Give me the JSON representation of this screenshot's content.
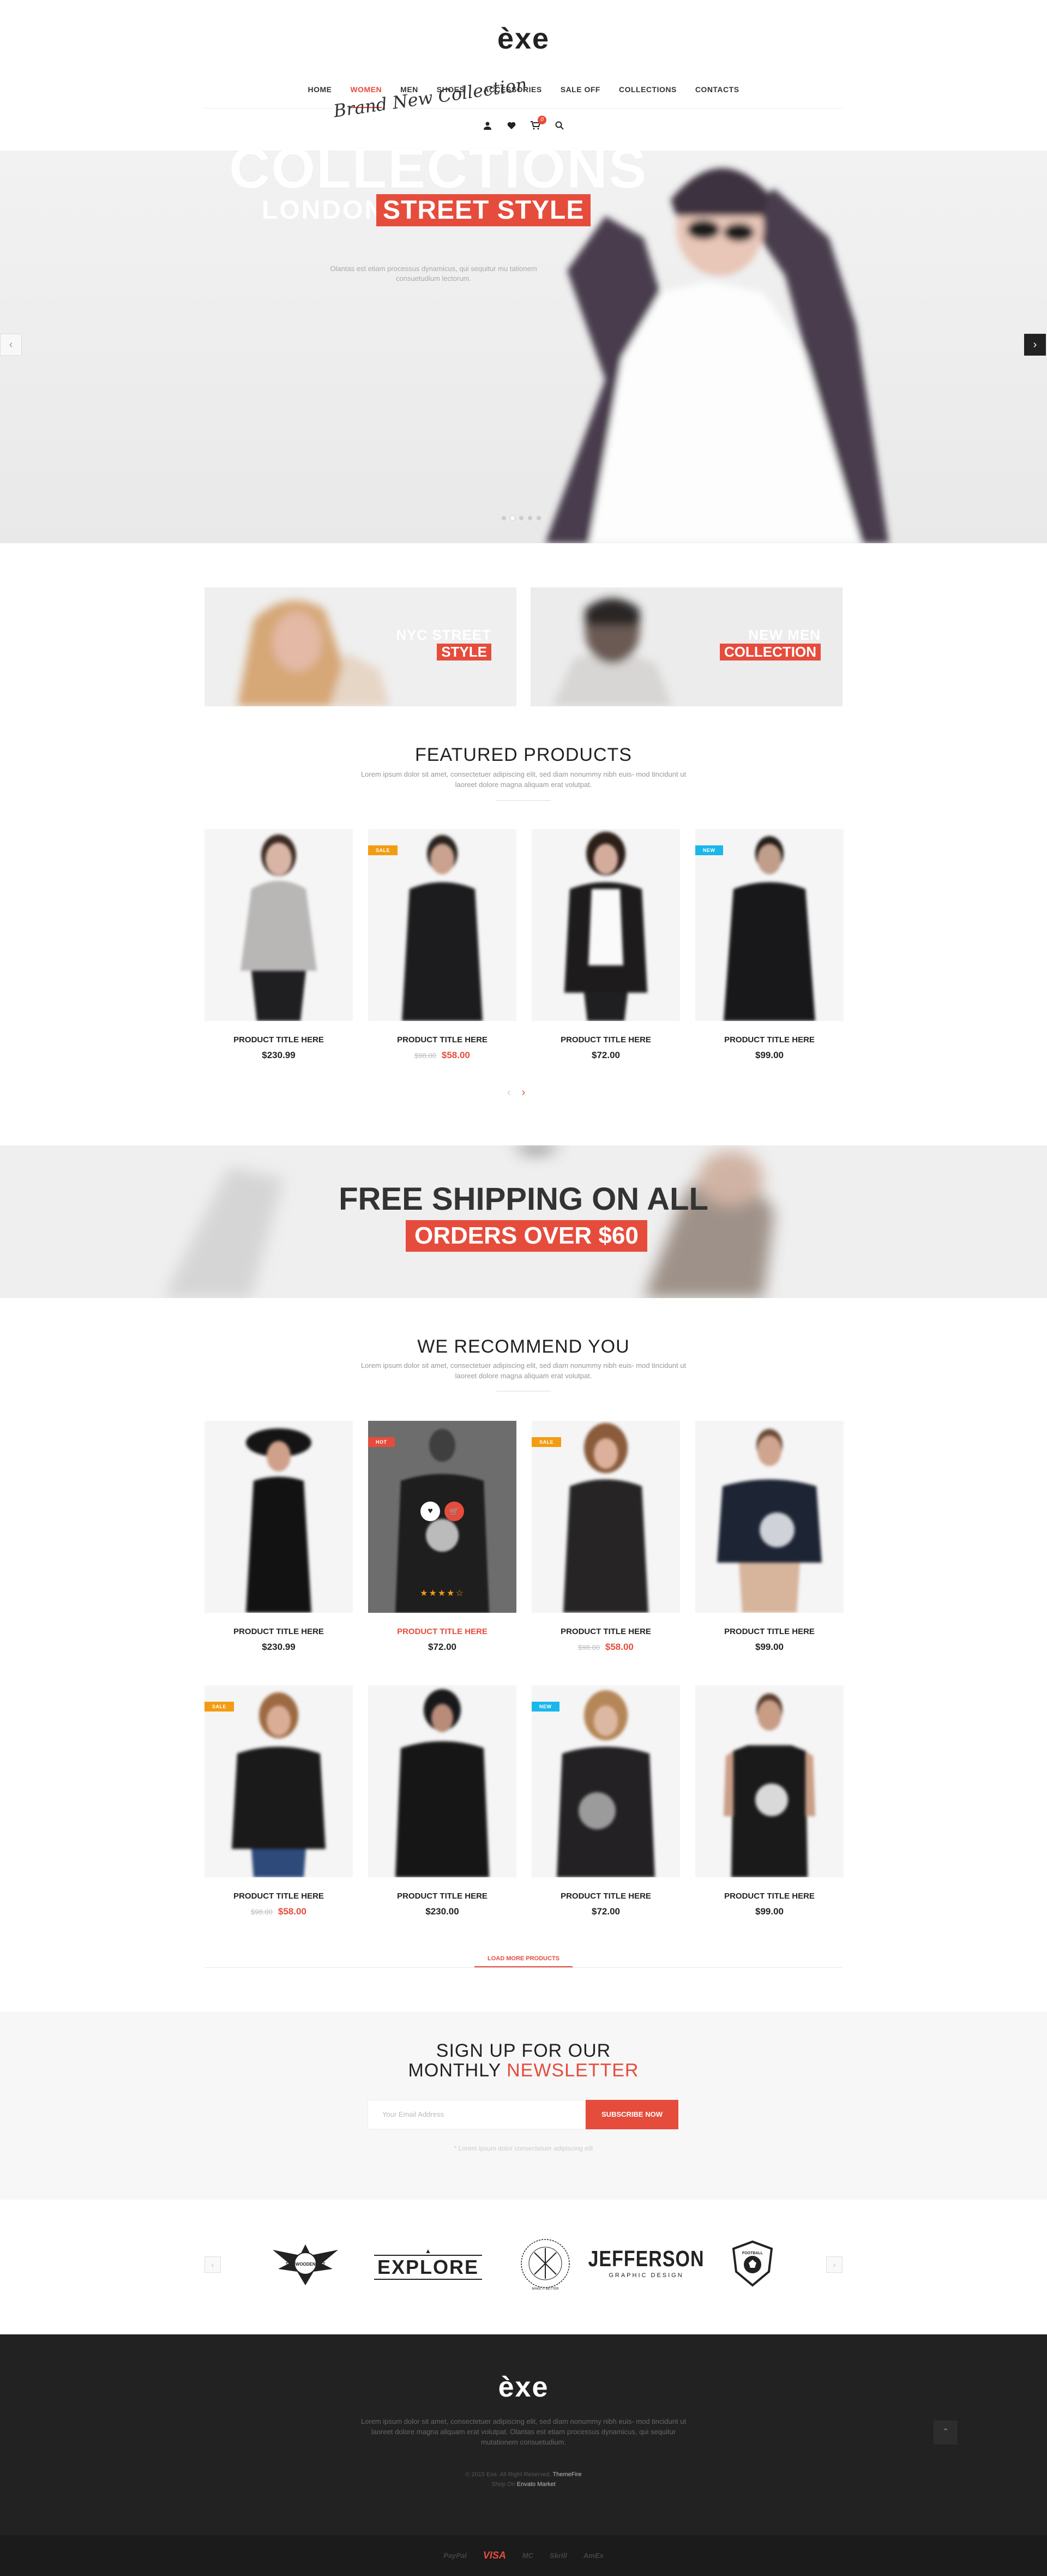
{
  "header": {
    "logo": "èxe",
    "nav": [
      "HOME",
      "WOMEN",
      "MEN",
      "SHOES",
      "ACCESSORIES",
      "SALE OFF",
      "COLLECTIONS",
      "CONTACTS"
    ],
    "active_nav": "WOMEN",
    "icons": [
      "user-icon",
      "heart-icon",
      "cart-icon",
      "search-icon"
    ],
    "cart_count": "0"
  },
  "hero": {
    "script": "Brand New Collection",
    "title": "COLLECTIONS",
    "subtitle_plain": "LONDON",
    "subtitle_highlight": "STREET STYLE",
    "description": "Olantas est etiam processus dynamicus, qui sequitur mu tationem consuetudium lectorum.",
    "prev": "‹",
    "next": "›"
  },
  "promos": [
    {
      "line1": "NYC STREET",
      "line2": "STYLE"
    },
    {
      "line1": "NEW MEN",
      "line2": "COLLECTION"
    }
  ],
  "featured": {
    "title": "FEATURED PRODUCTS",
    "description": "Lorem ipsum dolor sit amet, consectetuer adipiscing elit, sed diam nonummy nibh euis- mod tincidunt ut laoreet dolore magna aliquam erat volutpat.",
    "products": [
      {
        "title": "PRODUCT TITLE HERE",
        "price": "$230.99",
        "old_price": "",
        "badge": ""
      },
      {
        "title": "PRODUCT TITLE HERE",
        "price": "$58.00",
        "old_price": "$98.00",
        "badge": "SALE"
      },
      {
        "title": "PRODUCT TITLE HERE",
        "price": "$72.00",
        "old_price": "",
        "badge": ""
      },
      {
        "title": "PRODUCT TITLE HERE",
        "price": "$99.00",
        "old_price": "",
        "badge": "NEW"
      }
    ],
    "pager_prev": "‹",
    "pager_next": "›"
  },
  "shipping": {
    "line1": "FREE SHIPPING ON ALL",
    "line2": "ORDERS OVER $60"
  },
  "recommend": {
    "title": "WE RECOMMEND YOU",
    "description": "Lorem ipsum dolor sit amet, consectetuer adipiscing elit, sed diam nonummy nibh euis- mod tincidunt ut laoreet dolore magna aliquam erat volutpat.",
    "products": [
      {
        "title": "PRODUCT TITLE HERE",
        "price": "$230.99",
        "old_price": "",
        "badge": ""
      },
      {
        "title": "PRODUCT TITLE HERE",
        "price": "$72.00",
        "old_price": "",
        "badge": "HOT"
      },
      {
        "title": "PRODUCT TITLE HERE",
        "price": "$58.00",
        "old_price": "$98.00",
        "badge": "SALE"
      },
      {
        "title": "PRODUCT TITLE HERE",
        "price": "$99.00",
        "old_price": "",
        "badge": ""
      },
      {
        "title": "PRODUCT TITLE HERE",
        "price": "$58.00",
        "old_price": "$98.00",
        "badge": "SALE"
      },
      {
        "title": "PRODUCT TITLE HERE",
        "price": "$230.00",
        "old_price": "",
        "badge": ""
      },
      {
        "title": "PRODUCT TITLE HERE",
        "price": "$72.00",
        "old_price": "",
        "badge": "NEW"
      },
      {
        "title": "PRODUCT TITLE HERE",
        "price": "$99.00",
        "old_price": "",
        "badge": ""
      }
    ],
    "hover_rating": "★★★★☆",
    "load_more": "LOAD MORE PRODUCTS"
  },
  "newsletter": {
    "line1": "SIGN UP FOR OUR",
    "line2_plain": "MONTHLY",
    "line2_highlight": "NEWSLETTER",
    "placeholder": "Your Email Address",
    "button": "SUBSCRIBE NOW",
    "note": "* Lorem ipsum dolor consectetuer adipiscing elit"
  },
  "brands": [
    {
      "name": "eagle-badge-logo",
      "text": "THE WOODEN EST"
    },
    {
      "name": "explore-logo",
      "text": "EXPLORE"
    },
    {
      "name": "arrows-circle-logo",
      "text": "MAKE IT BETTER"
    },
    {
      "name": "jefferson-logo",
      "text": "JEFFERSON",
      "sub": "GRAPHIC DESIGN"
    },
    {
      "name": "football-shield-logo",
      "text": "FOOTBALL"
    }
  ],
  "footer": {
    "logo": "èxe",
    "description": "Lorem ipsum dolor sit amet, consectetuer adipiscing elit, sed diam nonummy nibh euis- mod tincidunt ut laoreet dolore magna aliquam erat volutpat. Olantas est etiam processus dynamicus, qui sequitur mutationem consuetudium.",
    "copyright": "© 2015 Exe. All Right Reserved.",
    "copyright_link": "ThemeFire",
    "shop_on": "Shop On",
    "shop_link": "Envato Market",
    "to_top": "⌃",
    "payments": [
      "PayPal",
      "VISA",
      "MC",
      "Skrill",
      "AmEx"
    ]
  },
  "colors": {
    "accent": "#e64c3c",
    "sale": "#f39c12",
    "new": "#1ab7ea",
    "footer": "#222222"
  }
}
